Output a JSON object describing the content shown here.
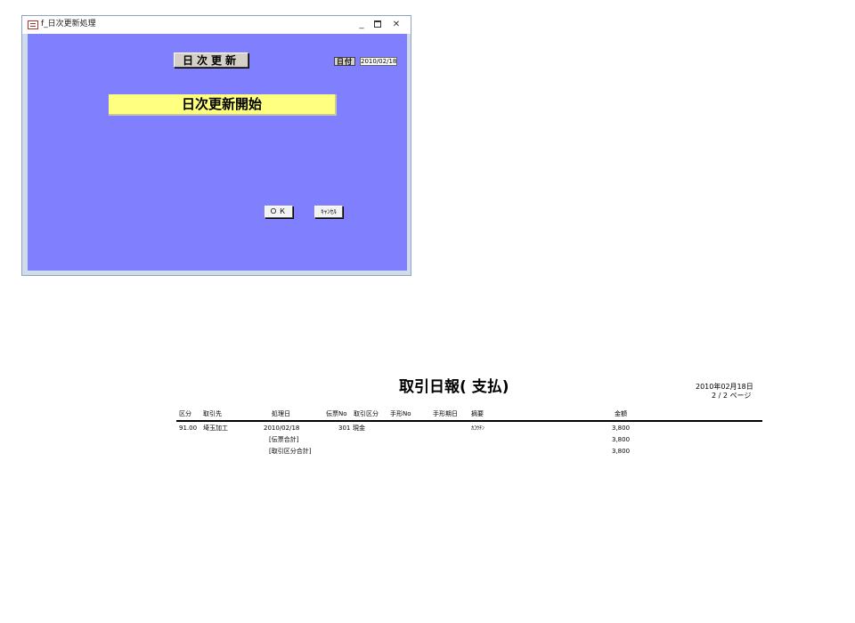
{
  "window": {
    "title": "f_日次更新処理",
    "controls": {
      "minimize": "_",
      "close": "✕"
    }
  },
  "form": {
    "header_button": "日次更新",
    "date_label": "日付",
    "date_value": "2010/02/18",
    "banner": "日次更新開始",
    "ok_button": "ＯＫ",
    "cancel_button": "ｷｬﾝｾﾙ",
    "colors": {
      "form_bg": "#8080ff",
      "banner_bg": "#ffff80"
    }
  },
  "report": {
    "title": "取引日報( 支払)",
    "date": "2010年02月18日",
    "page": "2 / 2 ページ",
    "headers": {
      "kubun": "区分",
      "torihikisaki": "取引先",
      "shoribi": "処理日",
      "denpyo_no": "伝票No",
      "torihiki_kubun": "取引区分",
      "tegata_no": "手形No",
      "tegata_kijitsu": "手形期日",
      "tekiyo": "摘要",
      "kingaku": "金額"
    },
    "row": {
      "kubun": "91.00",
      "torihikisaki": "埼玉加工",
      "shoribi": "2010/02/18",
      "denpyo_no": "301",
      "torihiki_kubun": "現金",
      "tekiyo": "ｶｺｳﾁﾝ",
      "kingaku": "3,800"
    },
    "subtotals": [
      {
        "label": "[伝票合計]",
        "amount": "3,800"
      },
      {
        "label": "[取引区分合計]",
        "amount": "3,800"
      }
    ]
  }
}
